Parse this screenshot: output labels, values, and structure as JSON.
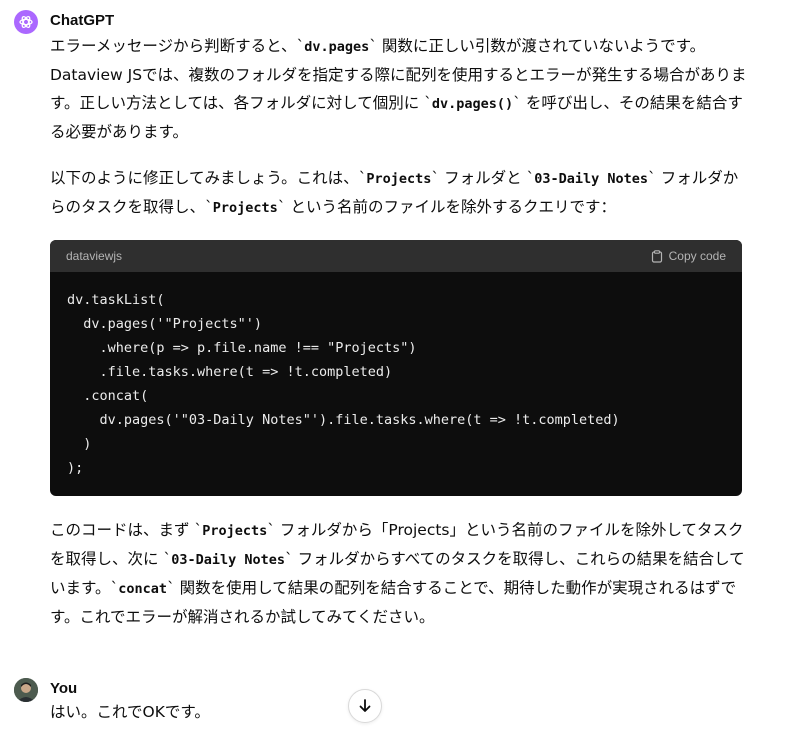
{
  "assistant": {
    "name": "ChatGPT",
    "p1": {
      "a": "エラーメッセージから判断すると、`",
      "code1": "dv.pages",
      "b": "` 関数に正しい引数が渡されていないようです。Dataview JSでは、複数のフォルダを指定する際に配列を使用するとエラーが発生する場合があります。正しい方法としては、各フォルダに対して個別に `",
      "code2": "dv.pages()",
      "c": "` を呼び出し、その結果を結合する必要があります。"
    },
    "p2": {
      "a": "以下のように修正してみましょう。これは、`",
      "code1": "Projects",
      "b": "` フォルダと `",
      "code2": "03-Daily Notes",
      "c": "` フォルダからのタスクを取得し、`",
      "code3": "Projects",
      "d": "` という名前のファイルを除外するクエリです："
    },
    "code": {
      "language": "dataviewjs",
      "copy_label": "Copy code",
      "lines": [
        "dv.taskList(",
        "  dv.pages('\"Projects\"')",
        "    .where(p => p.file.name !== \"Projects\")",
        "    .file.tasks.where(t => !t.completed)",
        "  .concat(",
        "    dv.pages('\"03-Daily Notes\"').file.tasks.where(t => !t.completed)",
        "  )",
        ");"
      ]
    },
    "p3": {
      "a": "このコードは、まず `",
      "code1": "Projects",
      "b": "` フォルダから「Projects」という名前のファイルを除外してタスクを取得し、次に `",
      "code2": "03-Daily Notes",
      "c": "` フォルダからすべてのタスクを取得し、これらの結果を結合しています。`",
      "code3": "concat",
      "d": "` 関数を使用して結果の配列を結合することで、期待した動作が実現されるはずです。これでエラーが解消されるか試してみてください。"
    }
  },
  "user": {
    "name": "You",
    "message": "はい。これでOKです。"
  }
}
